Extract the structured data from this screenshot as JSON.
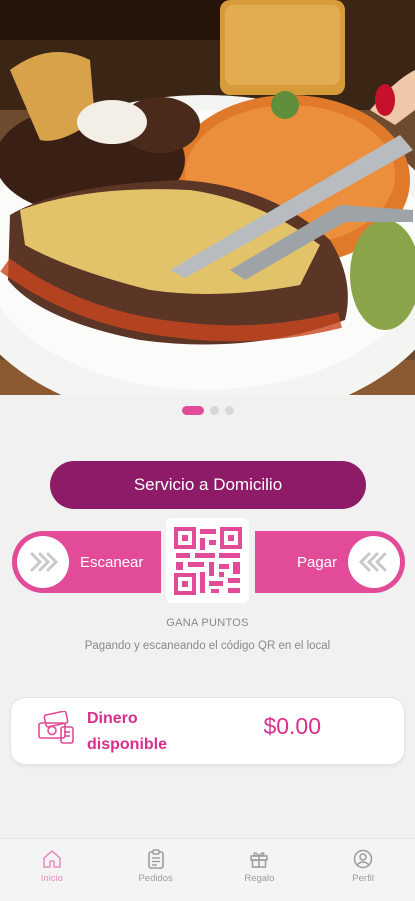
{
  "hero": {
    "image": "food-photo",
    "active_slide": 1,
    "total_slides": 3
  },
  "delivery_button": {
    "label": "Servicio a Domicilio"
  },
  "scan": {
    "label": "Escanear",
    "icon": "double-chevron-right-icon"
  },
  "pay": {
    "label": "Pagar",
    "icon": "double-chevron-left-icon"
  },
  "qr": {
    "icon": "qr-code-icon"
  },
  "points": {
    "title": "GANA PUNTOS",
    "subtitle": "Pagando y escaneando el código QR en el local"
  },
  "money": {
    "label": "Dinero disponible",
    "value": "$0.00",
    "icon": "cash-icon"
  },
  "tabs": [
    {
      "label": "Inicio",
      "icon": "home-icon",
      "active": true
    },
    {
      "label": "Pedidos",
      "icon": "clipboard-icon",
      "active": false
    },
    {
      "label": "Regalo",
      "icon": "gift-icon",
      "active": false
    },
    {
      "label": "Perfil",
      "icon": "user-circle-icon",
      "active": false
    }
  ],
  "colors": {
    "primary": "#8e1b68",
    "accent": "#e24b97",
    "money_text": "#d82f8c",
    "background": "#f1f1f1"
  }
}
